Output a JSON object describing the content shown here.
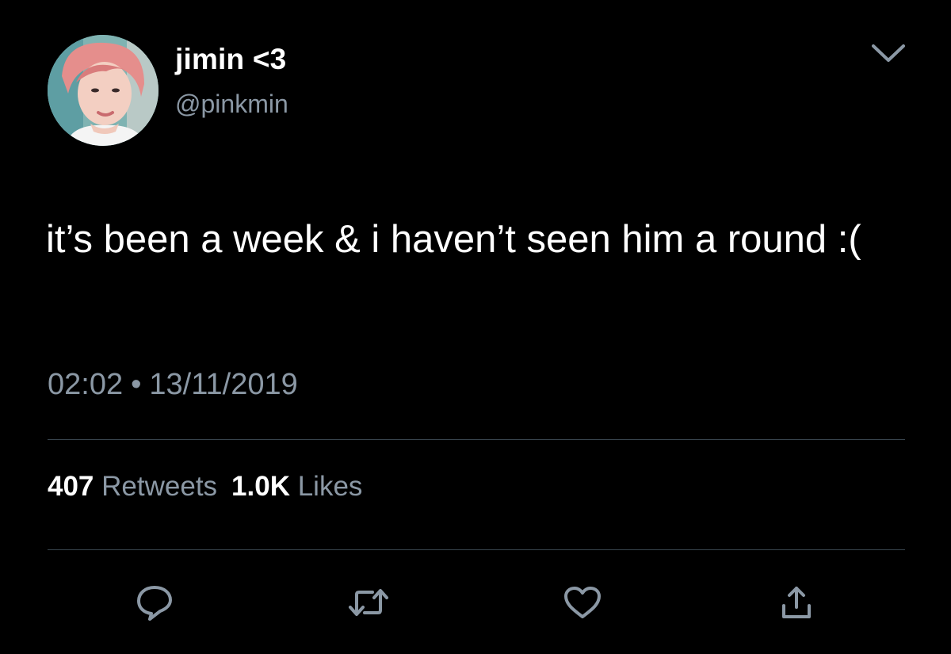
{
  "user": {
    "display_name": "jimin <3",
    "handle": "@pinkmin",
    "avatar_icon": "profile-photo"
  },
  "tweet": {
    "text": "it’s been a week & i haven’t seen him a round :(",
    "time": "02:02",
    "separator": "•",
    "date": "13/11/2019"
  },
  "stats": {
    "retweets_count": "407",
    "retweets_label": "Retweets",
    "likes_count": "1.0K",
    "likes_label": "Likes"
  },
  "actions": [
    {
      "icon": "reply-icon"
    },
    {
      "icon": "retweet-icon"
    },
    {
      "icon": "like-icon"
    },
    {
      "icon": "share-icon"
    }
  ],
  "colors": {
    "background": "#000000",
    "primary_text": "#ffffff",
    "secondary_text": "#8b98a5",
    "divider": "#38444d",
    "icon": "#8b98a5"
  }
}
